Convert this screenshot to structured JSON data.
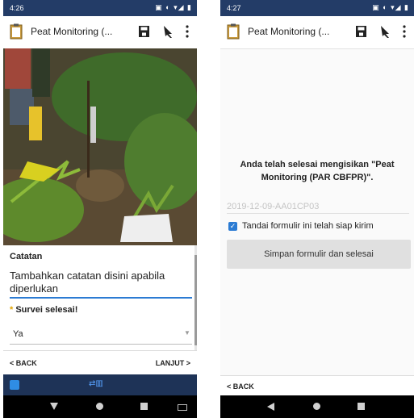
{
  "left_screen": {
    "status": {
      "time": "4:26",
      "icons": "▣ ◐ ▾◢ ▮"
    },
    "appbar": {
      "title": "Peat Monitoring (...",
      "icons": [
        "clipboard-icon",
        "save-icon",
        "navigate-icon",
        "more-vert-icon"
      ]
    },
    "note_field": {
      "label": "Catatan",
      "value": "Tambahkan catatan disini apabila diperlukan"
    },
    "survey_field": {
      "required_marker": "*",
      "label": "Survei selesai!",
      "selected": "Ya"
    },
    "bottom_nav": {
      "back": "< BACK",
      "next": "LANJUT >"
    },
    "notify_icons": [
      "app-icon",
      "sync-icon"
    ]
  },
  "right_screen": {
    "status": {
      "time": "4:27",
      "icons": "▣ ◐ ▾◢ ▮"
    },
    "appbar": {
      "title": "Peat Monitoring (...",
      "icons": [
        "clipboard-icon",
        "save-icon",
        "navigate-icon",
        "more-vert-icon"
      ]
    },
    "finish_message": "Anda telah selesai mengisikan \"Peat Monitoring (PAR CBFPR)\".",
    "form_instance_name": "2019-12-09-AA01CP03",
    "checkbox": {
      "checked": true,
      "label": "Tandai formulir ini telah siap kirim"
    },
    "save_button": "Simpan formulir dan selesai",
    "bottom_nav": {
      "back": "< BACK"
    }
  },
  "colors": {
    "status_bar": "#233c67",
    "accent": "#2b7bd3",
    "notify_bar": "#1e3357"
  }
}
